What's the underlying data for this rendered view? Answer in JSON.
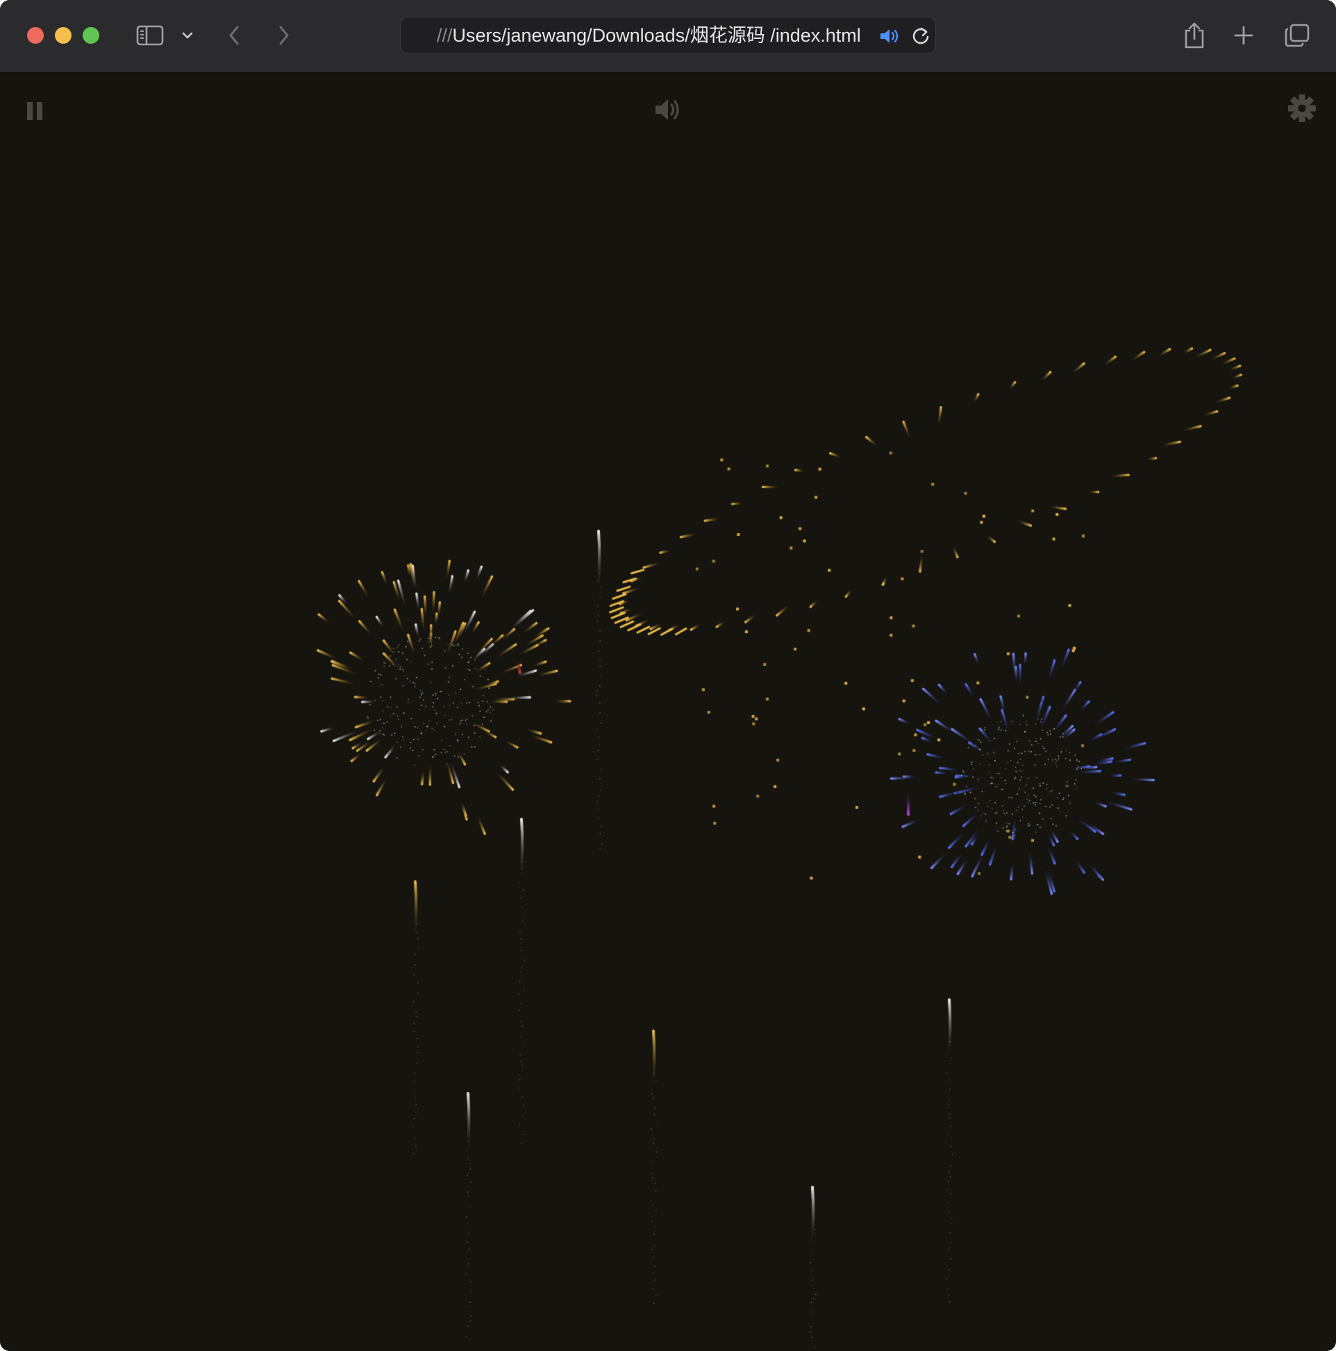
{
  "browser": {
    "url_prefix": "///",
    "url_path": "Users/janewang/Downloads/烟花源码 /index.html",
    "icons": {
      "sidebar": "sidebar-icon",
      "chevron": "chevron-down-icon",
      "back": "back-arrow-icon",
      "forward": "forward-arrow-icon",
      "audio": "speaker-playing-icon",
      "reload": "reload-icon",
      "share": "share-icon",
      "new_tab": "plus-icon",
      "tabs": "tab-overview-icon"
    },
    "audio_color": "#4e8ef7"
  },
  "page": {
    "background": "#16140f",
    "controls": {
      "pause": "pause-icon",
      "sound": "speaker-icon",
      "settings": "gear-icon"
    },
    "control_color": "#4a4842"
  },
  "fireworks": {
    "palette": {
      "gold": "#e8b84a",
      "white": "#e8e8e8",
      "blue": "#5a72f0",
      "red": "#e03a3a",
      "purple": "#b04ae0"
    }
  }
}
